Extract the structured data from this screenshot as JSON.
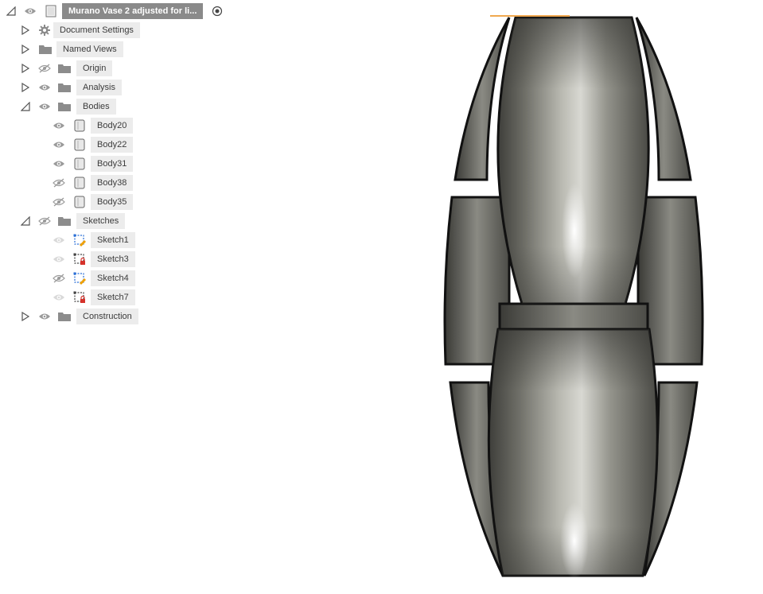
{
  "browser": {
    "root": {
      "label": "Murano Vase 2 adjusted for li...",
      "visible": true
    },
    "items": [
      {
        "label": "Document Settings",
        "expanded": false,
        "icon": "gear-icon"
      },
      {
        "label": "Named Views",
        "expanded": false,
        "icon": "folder-icon"
      },
      {
        "label": "Origin",
        "expanded": false,
        "visible": false,
        "icon": "folder-icon"
      },
      {
        "label": "Analysis",
        "expanded": false,
        "visible": true,
        "icon": "folder-icon"
      },
      {
        "label": "Bodies",
        "expanded": true,
        "visible": true,
        "icon": "folder-icon"
      },
      {
        "label": "Sketches",
        "expanded": true,
        "visible": false,
        "icon": "folder-icon"
      },
      {
        "label": "Construction",
        "expanded": false,
        "visible": true,
        "icon": "folder-icon"
      }
    ],
    "bodies": [
      {
        "label": "Body20",
        "visible": true
      },
      {
        "label": "Body22",
        "visible": true
      },
      {
        "label": "Body31",
        "visible": true
      },
      {
        "label": "Body38",
        "visible": false
      },
      {
        "label": "Body35",
        "visible": false
      }
    ],
    "sketches": [
      {
        "label": "Sketch1",
        "state": "dimmed"
      },
      {
        "label": "Sketch3",
        "state": "dimmed"
      },
      {
        "label": "Sketch4",
        "state": "hidden"
      },
      {
        "label": "Sketch7",
        "state": "dimmed"
      }
    ]
  },
  "viewport": {
    "model": "vase-model"
  },
  "colors": {
    "label_bg": "#ececec",
    "root_bg": "#8a8a8a",
    "icon_gray": "#8c8c8c",
    "sketch_blue": "#2b6fd6",
    "sketch_red": "#d6322b"
  }
}
